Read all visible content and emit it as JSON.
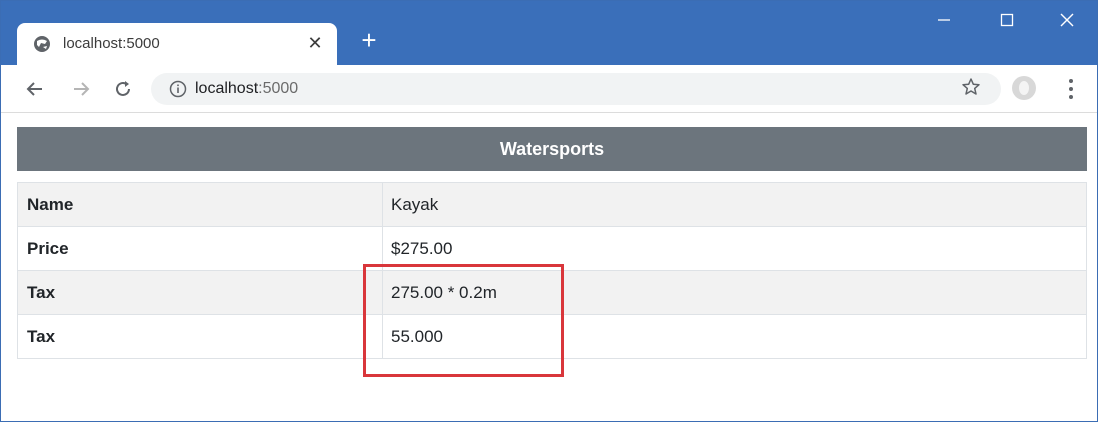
{
  "browser": {
    "tab_title": "localhost:5000",
    "url_host": "localhost",
    "url_port": ":5000",
    "icons": {
      "favicon": "globe-icon",
      "tab_close": "close-icon",
      "new_tab": "plus-icon",
      "back": "arrow-left-icon",
      "forward": "arrow-right-icon",
      "reload": "reload-icon",
      "site_info": "info-icon",
      "bookmark": "star-icon",
      "profile": "avatar-icon",
      "menu": "kebab-menu-icon",
      "minimize": "minimize-icon",
      "maximize": "maximize-icon",
      "close": "close-icon"
    },
    "colors": {
      "titlebar": "#3a6fba",
      "omnibox": "#f1f3f4"
    }
  },
  "page": {
    "heading": "Watersports",
    "rows": [
      {
        "label": "Name",
        "value": "Kayak"
      },
      {
        "label": "Price",
        "value": "$275.00"
      },
      {
        "label": "Tax",
        "value": "275.00 * 0.2m"
      },
      {
        "label": "Tax",
        "value": "55.000"
      }
    ],
    "colors": {
      "heading_bg": "#6c757d",
      "highlight": "#d9363b",
      "stripe": "#f2f2f2"
    }
  }
}
